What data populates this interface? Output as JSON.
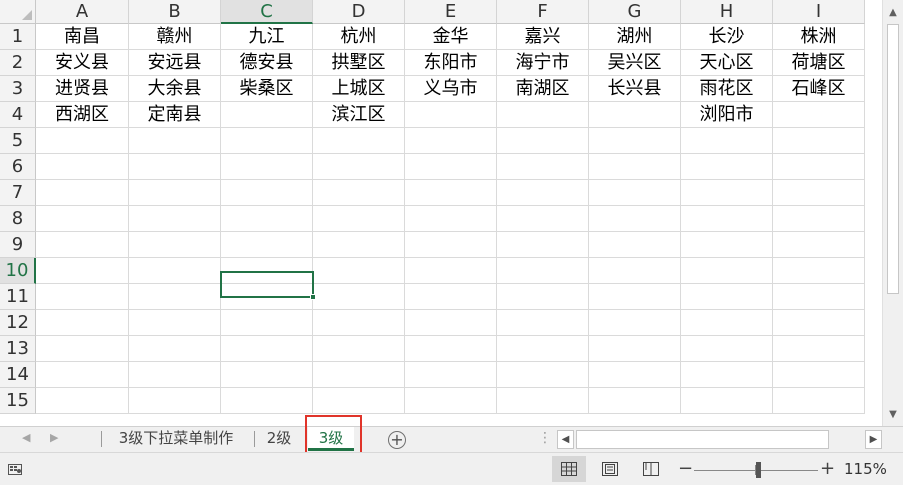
{
  "columns": [
    "A",
    "B",
    "C",
    "D",
    "E",
    "F",
    "G",
    "H",
    "I"
  ],
  "active_column": "C",
  "rows": [
    "1",
    "2",
    "3",
    "4",
    "5",
    "6",
    "7",
    "8",
    "9",
    "10",
    "11",
    "12",
    "13",
    "14",
    "15"
  ],
  "active_row": "10",
  "cells": [
    [
      "南昌",
      "赣州",
      "九江",
      "杭州",
      "金华",
      "嘉兴",
      "湖州",
      "长沙",
      "株洲"
    ],
    [
      "安义县",
      "安远县",
      "德安县",
      "拱墅区",
      "东阳市",
      "海宁市",
      "吴兴区",
      "天心区",
      "荷塘区"
    ],
    [
      "进贤县",
      "大余县",
      "柴桑区",
      "上城区",
      "义乌市",
      "南湖区",
      "长兴县",
      "雨花区",
      "石峰区"
    ],
    [
      "西湖区",
      "定南县",
      "",
      "滨江区",
      "",
      "",
      "",
      "浏阳市",
      ""
    ]
  ],
  "selected_cell": "C10",
  "sheet_tabs": [
    {
      "label": "3级下拉菜单制作",
      "active": false
    },
    {
      "label": "2级",
      "active": false
    },
    {
      "label": "3级",
      "active": true
    }
  ],
  "add_sheet_label": "+",
  "zoom": {
    "label": "115%",
    "value": 115,
    "min": 10,
    "max": 400
  },
  "view_modes": [
    "normal",
    "page-layout",
    "page-break-preview"
  ],
  "active_view_mode": "normal",
  "colors": {
    "accent": "#217346",
    "highlight_box": "#e0342a",
    "header_bg": "#f3f3f3",
    "gridline": "#dadada"
  }
}
